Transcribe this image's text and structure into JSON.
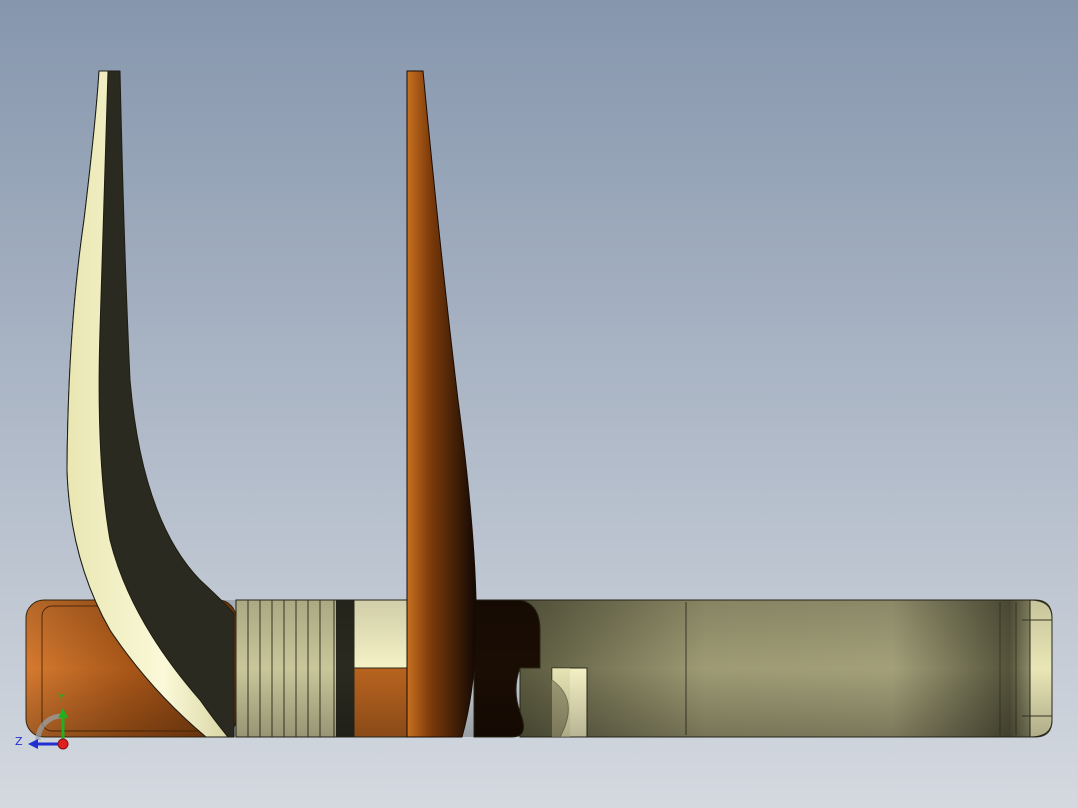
{
  "viewport": {
    "background_top": "#8696ad",
    "background_bottom": "#d4d9e0"
  },
  "triad": {
    "y_label": "Y",
    "z_label": "Z",
    "x_color": "#e02020",
    "y_color": "#20b020",
    "z_color": "#2030d0"
  },
  "parts": {
    "copper": "#b8631f",
    "cream": "#f3f0c4",
    "olive": "#c9c69a",
    "dark": "#2b2a20"
  }
}
